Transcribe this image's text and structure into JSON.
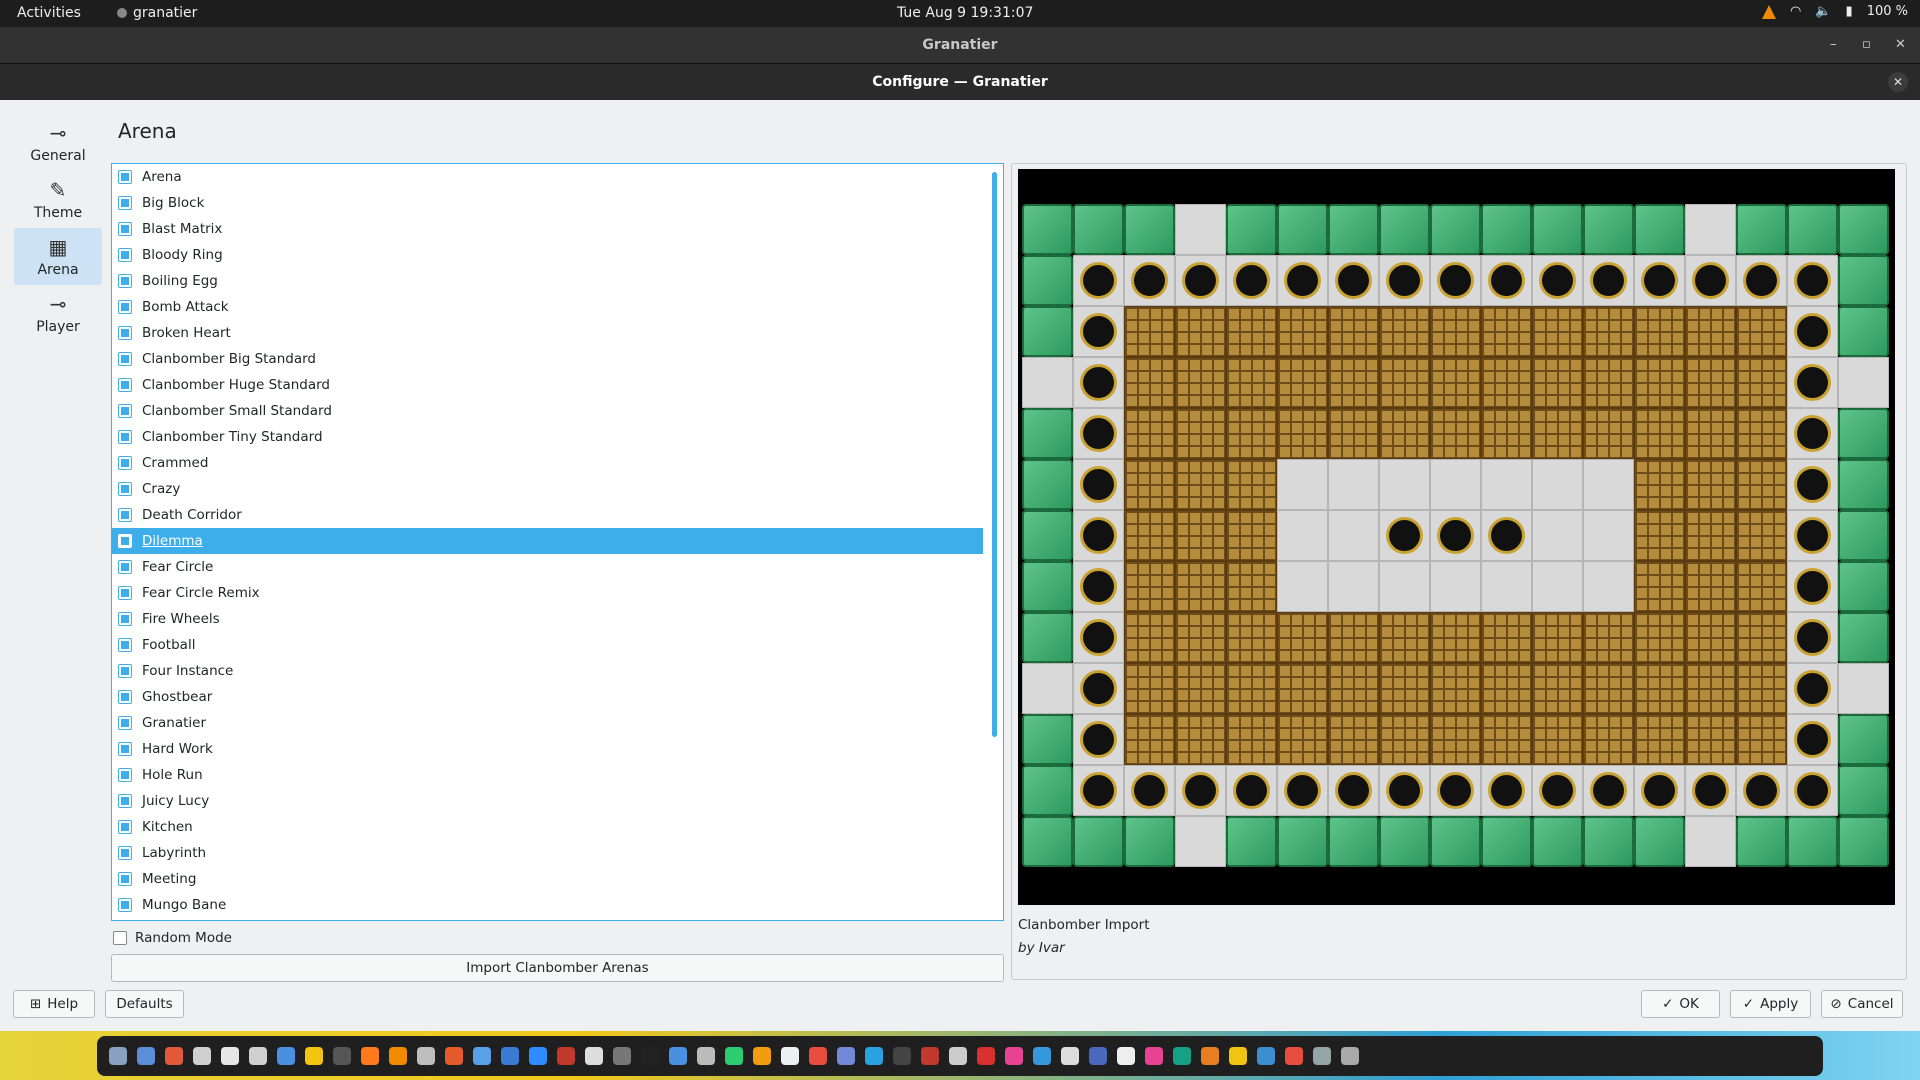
{
  "topbar": {
    "activities": "Activities",
    "app_name": "granatier",
    "clock": "Tue Aug 9  19:31:07",
    "battery": "100 %"
  },
  "window": {
    "title": "Granatier",
    "controls": [
      "–",
      "▫",
      "✕"
    ]
  },
  "dialog": {
    "title": "Configure — Granatier",
    "close": "✕"
  },
  "sidebar": {
    "items": [
      {
        "label": "General",
        "icon": "sliders-icon"
      },
      {
        "label": "Theme",
        "icon": "brush-icon"
      },
      {
        "label": "Arena",
        "icon": "grid-icon"
      },
      {
        "label": "Player",
        "icon": "sliders-icon"
      }
    ]
  },
  "page_title": "Arena",
  "arenas": [
    "Arena",
    "Big Block",
    "Blast Matrix",
    "Bloody Ring",
    "Boiling Egg",
    "Bomb Attack",
    "Broken Heart",
    "Clanbomber Big Standard",
    "Clanbomber Huge Standard",
    "Clanbomber Small Standard",
    "Clanbomber Tiny Standard",
    "Crammed",
    "Crazy",
    "Death Corridor",
    "Dilemma",
    "Fear Circle",
    "Fear Circle Remix",
    "Fire Wheels",
    "Football",
    "Four Instance",
    "Ghostbear",
    "Granatier",
    "Hard Work",
    "Hole Run",
    "Juicy Lucy",
    "Kitchen",
    "Labyrinth",
    "Meeting",
    "Mungo Bane"
  ],
  "selected_arena": "Dilemma",
  "random_mode": {
    "label": "Random Mode",
    "checked": false
  },
  "import_button": "Import Clanbomber Arenas",
  "preview": {
    "caption": "Clanbomber Import",
    "author": "by Ivar",
    "map": [
      "WWWGWWWWWWWWWGWWW",
      "WHHHHHHHHHHHHHHHW",
      "WHBBBBBBBBBBBBBHW",
      "GHBBBBBBBBBBBBBHG",
      "WHBBBBBBBBBBBBBHW",
      "WHBBBGGGGGGGBBBHW",
      "WHBBBGGHHHGGBBBHW",
      "WHBBBGGGGGGGBBBHW",
      "WHBBBBBBBBBBBBBHW",
      "GHBBBBBBBBBBBBBHG",
      "WHBBBBBBBBBBBBBHW",
      "WHHHHHHHHHHHHHHHW",
      "WWWGWWWWWWWWWGWWW"
    ]
  },
  "buttons": {
    "help": "Help",
    "defaults": "Defaults",
    "ok": "OK",
    "apply": "Apply",
    "cancel": "Cancel"
  },
  "colors": {
    "accent": "#3daee9",
    "wall": "#3fae73",
    "brick": "#b58b3c",
    "floor": "#d9d9d9"
  },
  "dock_app_colors": [
    "#8aa1c0",
    "#5c8fd6",
    "#e25a3a",
    "#cfcfcf",
    "#e6e6e6",
    "#cfcfcf",
    "#4a90e2",
    "#f1c40f",
    "#555555",
    "#ff7a1a",
    "#f08a00",
    "#bdbdbd",
    "#e55b2c",
    "#5aa0e8",
    "#3a7bd5",
    "#2d8cff",
    "#c0392b",
    "#dddddd",
    "#777777",
    "#222222",
    "#4a90e2",
    "#bbbbbb",
    "#2ecc71",
    "#f39c12",
    "#ecf0f1",
    "#e74c3c",
    "#7289da",
    "#2aa1e0",
    "#444444",
    "#c0392b",
    "#cccccc",
    "#d63031",
    "#e84393",
    "#3498db",
    "#dddddd",
    "#4a69bd",
    "#eeeeee",
    "#e84393",
    "#16a085",
    "#e67e22",
    "#f1c40f",
    "#3b8fd0",
    "#e74c3c",
    "#95a5a6",
    "#aaaaaa"
  ]
}
